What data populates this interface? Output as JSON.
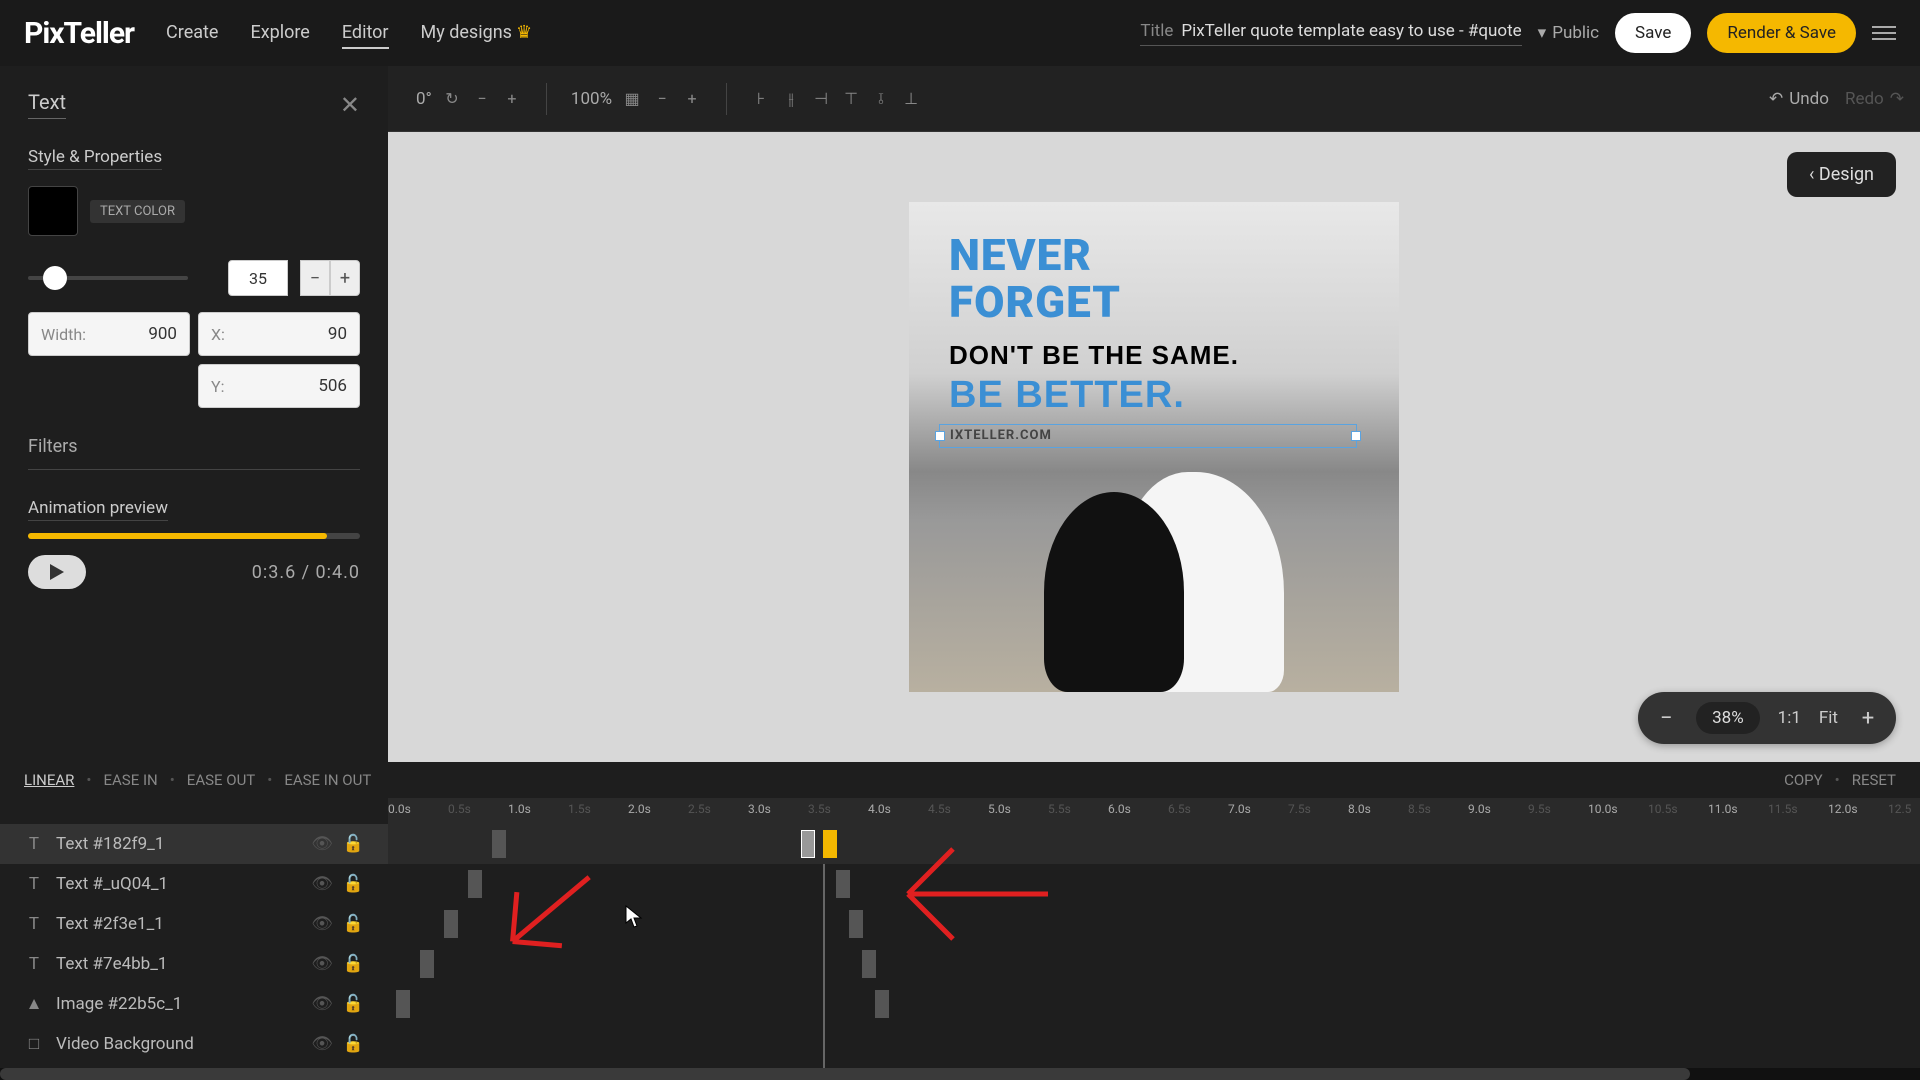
{
  "header": {
    "logo": "PixTeller",
    "nav": [
      "Create",
      "Explore",
      "Editor",
      "My designs"
    ],
    "active_nav": 2,
    "title_label": "Title",
    "title": "PixTeller quote template easy to use - #quote",
    "visibility": "Public",
    "save": "Save",
    "render": "Render & Save"
  },
  "toolbar": {
    "rotation": "0°",
    "zoom": "100%",
    "undo": "Undo",
    "redo": "Redo"
  },
  "panel": {
    "title": "Text",
    "section1": "Style & Properties",
    "color_label": "TEXT COLOR",
    "size": "35",
    "width_label": "Width:",
    "width": "900",
    "x_label": "X:",
    "x": "90",
    "y_label": "Y:",
    "y": "506",
    "filters": "Filters",
    "anim": "Animation preview",
    "time": "0:3.6 / 0:4.0"
  },
  "canvas": {
    "design_btn": "‹ Design",
    "line1a": "NEVER",
    "line1b": "FORGET",
    "line2": "DON'T BE THE SAME.",
    "line3": "BE BETTER.",
    "url": "IXTELLER.COM",
    "zoom_pct": "38%",
    "zoom_11": "1:1",
    "zoom_fit": "Fit"
  },
  "timeline": {
    "easings": [
      "LINEAR",
      "EASE IN",
      "EASE OUT",
      "EASE IN OUT"
    ],
    "active_easing": 0,
    "copy": "COPY",
    "reset": "RESET",
    "ruler": [
      "0.0s",
      "0.5s",
      "1.0s",
      "1.5s",
      "2.0s",
      "2.5s",
      "3.0s",
      "3.5s",
      "4.0s",
      "4.5s",
      "5.0s",
      "5.5s",
      "6.0s",
      "6.5s",
      "7.0s",
      "7.5s",
      "8.0s",
      "8.5s",
      "9.0s",
      "9.5s",
      "10.0s",
      "10.5s",
      "11.0s",
      "11.5s",
      "12.0s",
      "12.5"
    ],
    "layers": [
      {
        "icon": "T",
        "name": "Text #182f9_1",
        "sel": true
      },
      {
        "icon": "T",
        "name": "Text #_uQ04_1"
      },
      {
        "icon": "T",
        "name": "Text #2f3e1_1"
      },
      {
        "icon": "T",
        "name": "Text #7e4bb_1"
      },
      {
        "icon": "▲",
        "name": "Image #22b5c_1"
      },
      {
        "icon": "□",
        "name": "Video Background"
      }
    ]
  }
}
